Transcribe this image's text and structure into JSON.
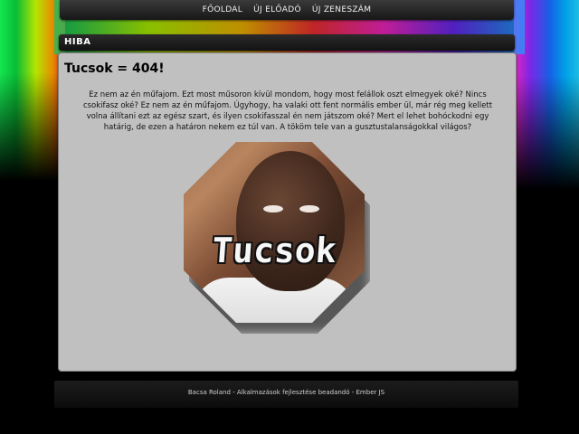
{
  "nav": {
    "items": [
      {
        "label": "FŐOLDAL"
      },
      {
        "label": "ÚJ ELŐADÓ"
      },
      {
        "label": "ÚJ ZENESZÁM"
      }
    ]
  },
  "panel": {
    "title": "HIBA",
    "heading": "Tucsok = 404!",
    "body": "Ez nem az én műfajom. Ezt most műsoron kívül mondom, hogy most felállok oszt elmegyek oké? Nincs csokifasz oké? Ez nem az én műfajom. Úgyhogy, ha valaki ott fent normális ember ül, már rég meg kellett volna állítani ezt az egész szart, és ilyen csokifasszal én nem játszom oké? Mert el lehet bohóckodni egy határig, de ezen a határon nekem ez túl van. A tököm tele van a gusztustalanságokkal világos?",
    "image_label": "Tucsok"
  },
  "footer": {
    "text": "Bacsa Roland - Alkalmazások fejlesztése beadandó - Ember JS"
  }
}
